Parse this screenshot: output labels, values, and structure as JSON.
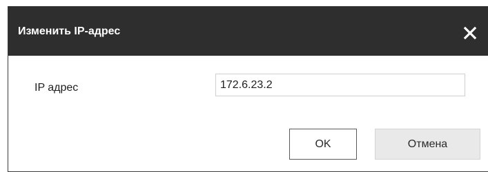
{
  "dialog": {
    "title": "Изменить IP-адрес",
    "close_icon": "close-icon"
  },
  "form": {
    "ip_label": "IP адрес",
    "ip_value": "172.6.23.2"
  },
  "buttons": {
    "ok_label": "OK",
    "cancel_label": "Отмена"
  },
  "colors": {
    "titlebar": "#2e2e2e",
    "title_text": "#ffffff",
    "cancel_bg": "#e9e9e9"
  }
}
